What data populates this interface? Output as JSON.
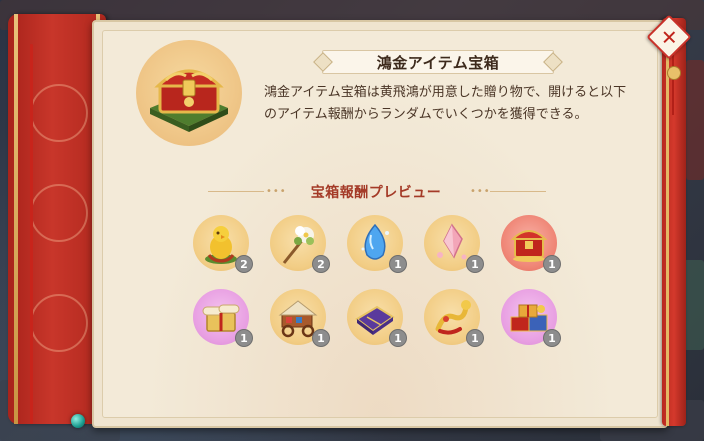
{
  "dialog": {
    "title": "鴻金アイテム宝箱",
    "description_line1": "鴻金アイテム宝箱は黄飛鴻が用意した贈り物で、開けると以下",
    "description_line2": "のアイテム報酬からランダムでいくつかを獲得できる。",
    "preview_title": "宝箱報酬プレビュー",
    "close_label": "✕"
  },
  "rewards": [
    {
      "icon": "golden-chick-icon",
      "count": "2",
      "bg": "gold"
    },
    {
      "icon": "flower-hairpin-icon",
      "count": "2",
      "bg": "gold"
    },
    {
      "icon": "blue-gem-icon",
      "count": "1",
      "bg": "gold"
    },
    {
      "icon": "pink-crystal-icon",
      "count": "1",
      "bg": "gold"
    },
    {
      "icon": "red-gift-chest-icon",
      "count": "1",
      "bg": "red"
    },
    {
      "icon": "scroll-bundle-icon",
      "count": "1",
      "bg": "purple"
    },
    {
      "icon": "merchant-cart-icon",
      "count": "1",
      "bg": "gold"
    },
    {
      "icon": "purple-book-box-icon",
      "count": "1",
      "bg": "gold"
    },
    {
      "icon": "golden-dragon-icon",
      "count": "1",
      "bg": "gold"
    },
    {
      "icon": "gift-pile-icon",
      "count": "1",
      "bg": "purple"
    }
  ],
  "colors": {
    "parchment": "#f3ead8",
    "scroll_red": "#c8362a",
    "title_text": "#3d2a1c",
    "section_text": "#a43a27",
    "badge": "#8d8d8d"
  }
}
